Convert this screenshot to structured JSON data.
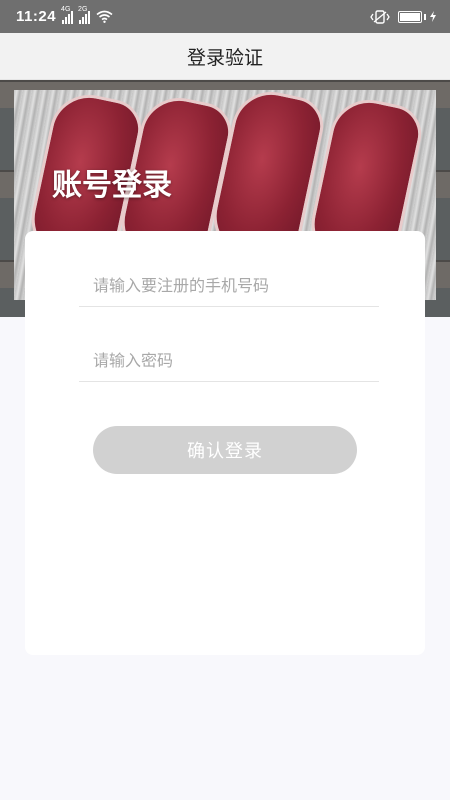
{
  "status_bar": {
    "time": "11:24",
    "signal1_tag": "4G",
    "signal2_tag": "2G",
    "icons": [
      "signal-icon",
      "signal-icon",
      "wifi-icon",
      "vibrate-icon",
      "battery-icon"
    ]
  },
  "app_bar": {
    "title": "登录验证"
  },
  "hero": {
    "title": "账号登录"
  },
  "form": {
    "phone_placeholder": "请输入要注册的手机号码",
    "password_placeholder": "请输入密码",
    "submit_label": "确认登录"
  },
  "colors": {
    "status_bar_bg": "#6f6f6f",
    "app_bar_bg": "#f2f2f2",
    "page_bg": "#f8f8fc",
    "button_bg": "#d1d1d1"
  }
}
